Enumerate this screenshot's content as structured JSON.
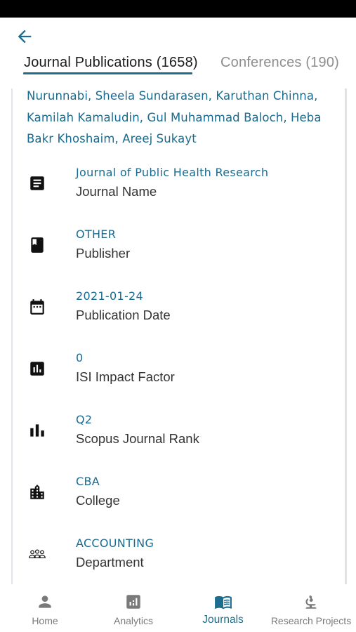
{
  "header": {
    "back_icon": "arrow-left-icon"
  },
  "tabs": [
    {
      "label": "Journal Publications (1658)",
      "active": true
    },
    {
      "label": "Conferences (190)",
      "active": false
    }
  ],
  "publication": {
    "authors": "Nurunnabi, Sheela Sundarasen, Karuthan Chinna, Kamilah Kamaludin, Gul Muhammad Baloch, Heba Bakr Khoshaim, Areej Sukayt",
    "details": [
      {
        "icon": "article-icon",
        "value": "Journal of Public Health Research",
        "label": "Journal Name"
      },
      {
        "icon": "book-icon",
        "value": "OTHER",
        "label": "Publisher"
      },
      {
        "icon": "calendar-icon",
        "value": "2021-01-24",
        "label": "Publication Date"
      },
      {
        "icon": "analytics-icon",
        "value": "0",
        "label": "ISI Impact Factor"
      },
      {
        "icon": "bar-chart-icon",
        "value": "Q2",
        "label": "Scopus Journal Rank"
      },
      {
        "icon": "building-icon",
        "value": "CBA",
        "label": "College"
      },
      {
        "icon": "group-icon",
        "value": "ACCOUNTING",
        "label": "Department"
      }
    ]
  },
  "bottom_nav": [
    {
      "label": "Home",
      "icon": "person-icon",
      "active": false
    },
    {
      "label": "Analytics",
      "icon": "analytics-icon",
      "active": false
    },
    {
      "label": "Journals",
      "icon": "open-book-icon",
      "active": true
    },
    {
      "label": "Research Projects",
      "icon": "microscope-icon",
      "active": false
    }
  ],
  "colors": {
    "accent": "#1d6d8e",
    "link_text": "#1a6b8f",
    "inactive_text": "#8e8e8e",
    "status_bar": "#000000"
  }
}
